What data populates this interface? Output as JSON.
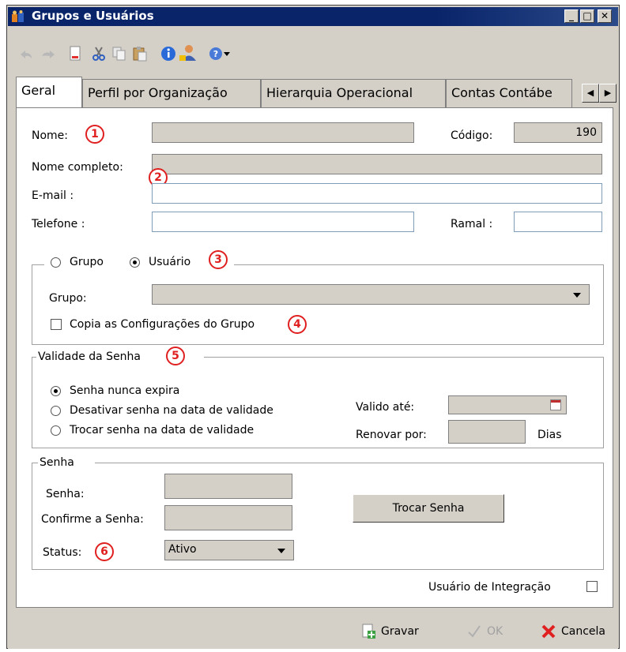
{
  "window": {
    "title": "Grupos e Usuários"
  },
  "toolbar": {
    "icons": [
      "undo-icon",
      "redo-icon",
      "new-document-icon",
      "cut-icon",
      "copy-icon",
      "paste-icon",
      "info-icon",
      "user-icon",
      "help-icon",
      "dropdown-icon"
    ]
  },
  "tabs": [
    "Geral",
    "Perfil por Organização",
    "Hierarquia Operacional",
    "Contas Contábe"
  ],
  "form": {
    "nome_label": "Nome:",
    "nome_value": "",
    "codigo_label": "Código:",
    "codigo_value": "190",
    "nome_completo_label": "Nome completo:",
    "nome_completo_value": "",
    "email_label": "E-mail :",
    "email_value": "",
    "telefone_label": "Telefone :",
    "telefone_value": "",
    "ramal_label": "Ramal :",
    "ramal_value": ""
  },
  "tipo": {
    "grupo_radio_label": "Grupo",
    "usuario_radio_label": "Usuário",
    "selected": "Usuário",
    "grupo_label": "Grupo:",
    "grupo_value": "",
    "copia_label": "Copia as Configurações do Grupo",
    "copia_checked": false
  },
  "validade": {
    "legend": "Validade da Senha",
    "options": [
      "Senha nunca expira",
      "Desativar senha na data de validade",
      "Trocar senha na data de validade"
    ],
    "selected": "Senha nunca expira",
    "valido_ate_label": "Valido até:",
    "valido_ate_value": "",
    "renovar_label": "Renovar por:",
    "renovar_value": "",
    "dias_label": "Dias"
  },
  "senha": {
    "legend": "Senha",
    "senha_label": "Senha:",
    "confirme_label": "Confirme a Senha:",
    "status_label": "Status:",
    "status_value": "Ativo",
    "trocar_button": "Trocar Senha"
  },
  "integracao": {
    "label": "Usuário de Integração",
    "checked": false
  },
  "badges": [
    "1",
    "2",
    "3",
    "4",
    "5",
    "6"
  ],
  "buttons": {
    "gravar": "Gravar",
    "ok": "OK",
    "cancela": "Cancela"
  },
  "colors": {
    "title_bar": "#0a246a",
    "badge": "#e02020",
    "window_bg": "#d4d0c8"
  }
}
